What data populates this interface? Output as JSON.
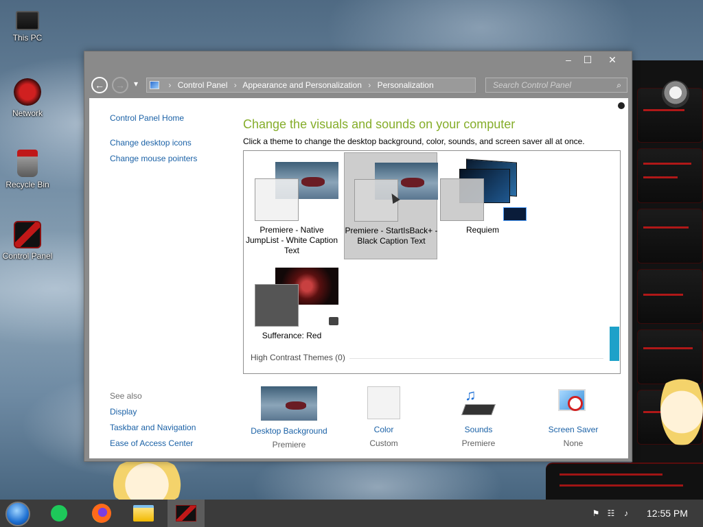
{
  "desktop": {
    "icons": [
      {
        "label": "This PC",
        "icon": "monitor-icon"
      },
      {
        "label": "Network",
        "icon": "network-icon"
      },
      {
        "label": "Recycle Bin",
        "icon": "recycle-bin-icon"
      },
      {
        "label": "Control Panel",
        "icon": "control-panel-icon"
      }
    ]
  },
  "window": {
    "buttons": {
      "minimize": "–",
      "maximize": "☐",
      "close": "✕"
    },
    "nav": {
      "back": "←",
      "forward": "→",
      "history": "▾"
    },
    "breadcrumb": [
      "Control Panel",
      "Appearance and Personalization",
      "Personalization"
    ],
    "breadcrumb_sep": "›",
    "search_placeholder": "Search Control Panel",
    "left_nav": {
      "home": "Control Panel Home",
      "desktop_icons": "Change desktop icons",
      "mouse_pointers": "Change mouse pointers",
      "see_also": "See also",
      "display": "Display",
      "taskbar": "Taskbar and Navigation",
      "ease": "Ease of Access Center"
    },
    "title": "Change the visuals and sounds on your computer",
    "description": "Click a theme to change the desktop background, color, sounds, and screen saver all at once.",
    "themes": [
      {
        "name": "Premiere - Native JumpList - White Caption Text",
        "selected": false
      },
      {
        "name": "Premiere - StartIsBack+ - Black Caption Text",
        "selected": true
      },
      {
        "name": "Requiem",
        "selected": false
      },
      {
        "name": "Sufferance: Red",
        "selected": false
      }
    ],
    "high_contrast": "High Contrast Themes (0)",
    "bottom": [
      {
        "label": "Desktop Background",
        "value": "Premiere"
      },
      {
        "label": "Color",
        "value": "Custom"
      },
      {
        "label": "Sounds",
        "value": "Premiere"
      },
      {
        "label": "Screen Saver",
        "value": "None"
      }
    ]
  },
  "taskbar": {
    "clock": "12:55 PM",
    "apps": [
      "start-orb-icon",
      "notes-icon",
      "firefox-icon",
      "file-explorer-icon",
      "control-panel-icon"
    ]
  },
  "colors": {
    "accent_link": "#1a61a6",
    "title_green": "#85ad2a",
    "scroll_accent": "#1da1c9"
  }
}
